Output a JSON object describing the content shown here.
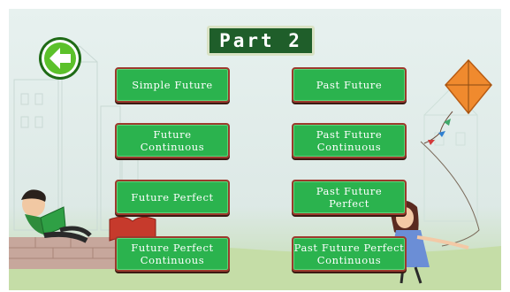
{
  "header": {
    "title": "Part 2"
  },
  "nav": {
    "back_icon": "arrow-left-icon"
  },
  "lessons": {
    "simple_future": "Simple Future",
    "past_future": "Past Future",
    "future_continuous": "Future\nContinuous",
    "past_future_continuous": "Past Future\nContinuous",
    "future_perfect": "Future Perfect",
    "past_future_perfect": "Past Future\nPerfect",
    "future_perfect_continuous": "Future Perfect\nContinuous",
    "past_future_perfect_continuous": "Past Future Perfect\nContinuous"
  },
  "colors": {
    "button_fill": "#2bb34e",
    "button_border": "#9c3a2d",
    "title_fill": "#1f5e2a",
    "back_button": "#5cc12a",
    "background": "#e7f1ef"
  }
}
